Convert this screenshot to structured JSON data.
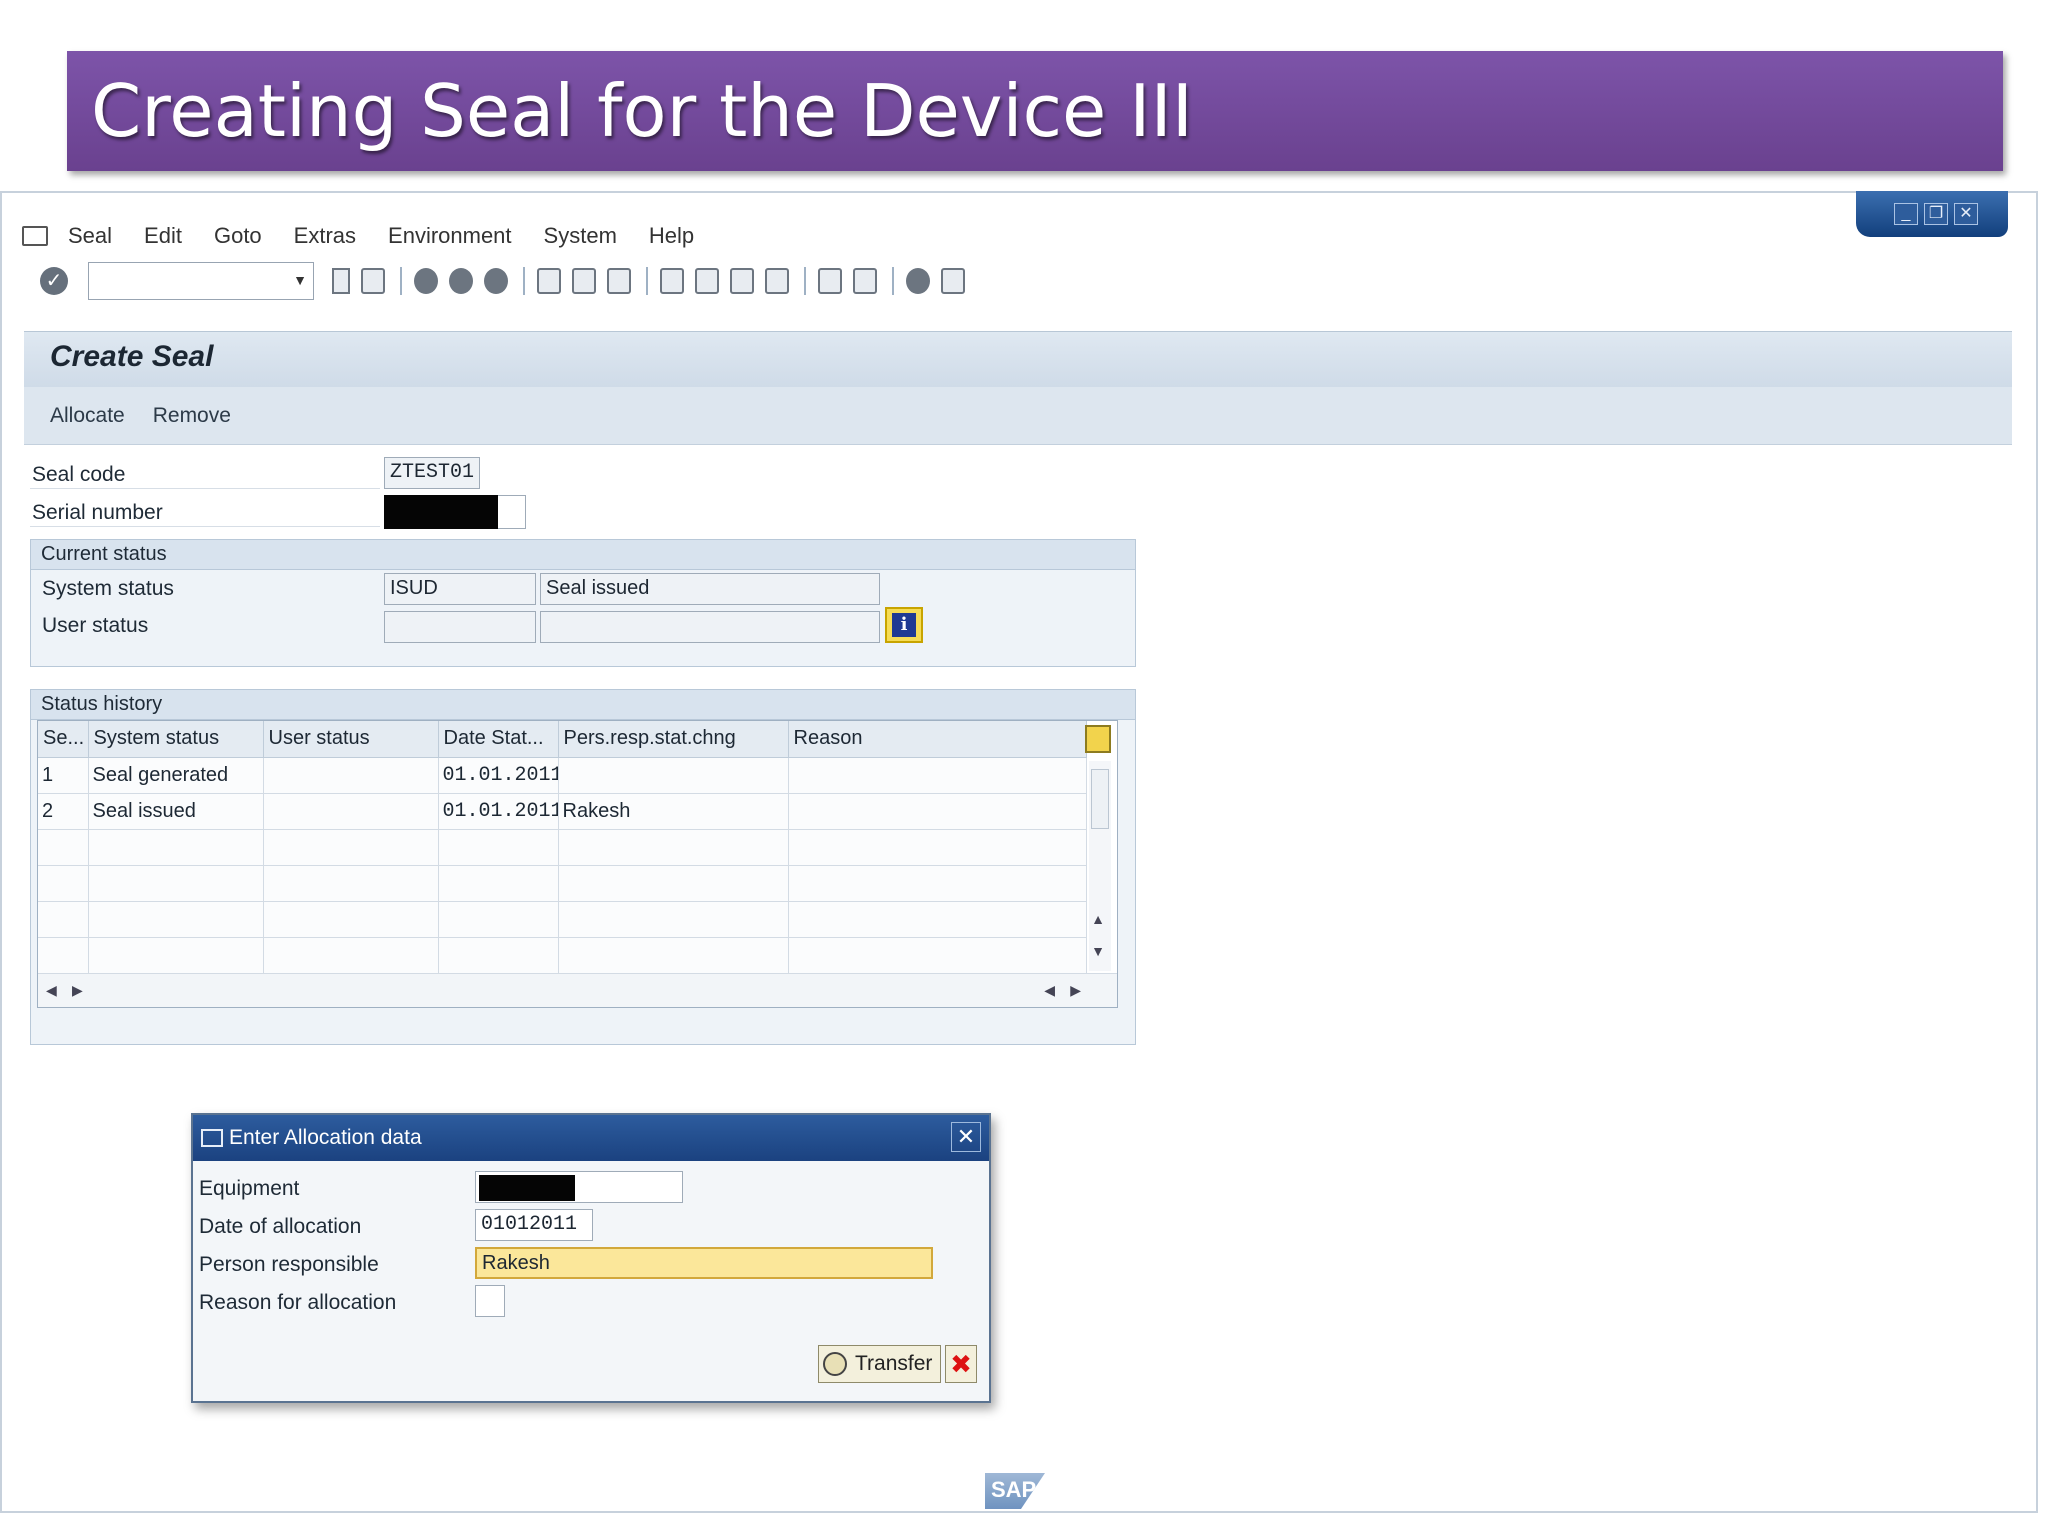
{
  "slide": {
    "title": "Creating Seal for the Device III"
  },
  "window": {
    "controls": [
      "_",
      "❐",
      "✕"
    ]
  },
  "menu": [
    "Seal",
    "Edit",
    "Goto",
    "Extras",
    "Environment",
    "System",
    "Help"
  ],
  "screen": {
    "title": "Create Seal",
    "app_toolbar": [
      "Allocate",
      "Remove"
    ]
  },
  "header_fields": {
    "seal_code_label": "Seal code",
    "seal_code_value": "ZTEST01",
    "serial_number_label": "Serial number"
  },
  "current_status": {
    "title": "Current status",
    "system_status_label": "System status",
    "system_status_code": "ISUD",
    "system_status_text": "Seal issued",
    "user_status_label": "User status",
    "info_icon": "i"
  },
  "status_history": {
    "title": "Status history",
    "columns": [
      "Se...",
      "System status",
      "User status",
      "Date Stat...",
      "Pers.resp.stat.chng",
      "Reason"
    ],
    "rows": [
      [
        "1",
        "Seal generated",
        "",
        "01.01.2011",
        "",
        ""
      ],
      [
        "2",
        "Seal issued",
        "",
        "01.01.2011",
        "Rakesh",
        ""
      ]
    ]
  },
  "dialog": {
    "title": "Enter Allocation data",
    "close": "✕",
    "fields": {
      "equipment_label": "Equipment",
      "date_label": "Date of allocation",
      "date_value": "01012011",
      "person_label": "Person responsible",
      "person_value": "Rakesh",
      "reason_label": "Reason for allocation"
    },
    "transfer_label": "Transfer",
    "cancel_label": "✖"
  },
  "footer": {
    "logo": "SAP"
  },
  "colors": {
    "banner": "#7350a0",
    "dialog_bar": "#234b8a",
    "required_field": "#fbe79a"
  }
}
